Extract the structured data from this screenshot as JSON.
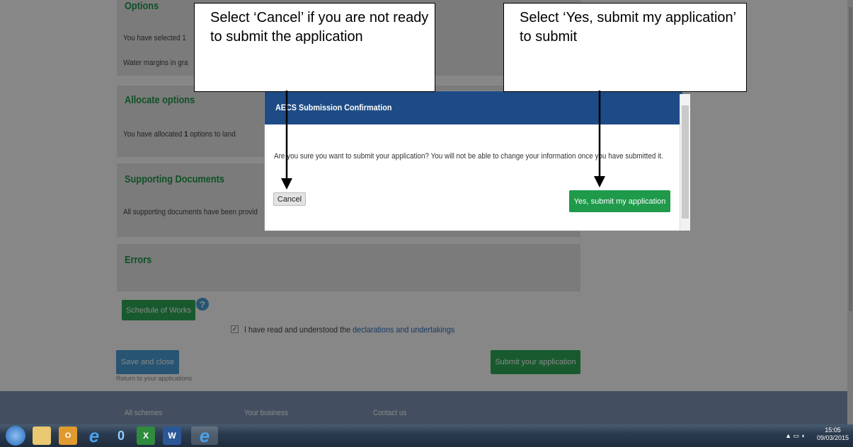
{
  "panels": {
    "options": {
      "title": "Options",
      "line1_prefix": "You have selected 1",
      "line2": "Water margins in gra"
    },
    "allocate": {
      "title": "Allocate options",
      "text_prefix": "You have allocated",
      "count": "1",
      "text_suffix": "options to land"
    },
    "supporting": {
      "title": "Supporting Documents",
      "text": "All supporting documents have been provid"
    },
    "errors": {
      "title": "Errors"
    }
  },
  "buttons": {
    "schedule": "Schedule of Works",
    "help_icon": "?",
    "save_close": "Save and close",
    "return_link": "Return to your applications",
    "submit_application": "Submit your application"
  },
  "declaration": {
    "text": "I have read and understood the",
    "link": "declarations and undertakings",
    "checked": true
  },
  "footer": {
    "col1": "All schemes",
    "col2": "Your business",
    "col3": "Contact us"
  },
  "modal": {
    "title": "AECS Submission Confirmation",
    "body": "Are you sure you want to submit your application? You will not be able to change your information once you have submitted it.",
    "cancel": "Cancel",
    "confirm": "Yes, submit my application"
  },
  "callouts": {
    "cancel_note": "Select ‘Cancel’ if you are not ready to submit the application",
    "submit_note": "Select ‘Yes, submit my application’ to submit"
  },
  "taskbar": {
    "icons": [
      "start-orb-icon",
      "file-explorer-icon",
      "outlook-icon",
      "internet-explorer-icon",
      "app-icon",
      "excel-icon",
      "word-icon",
      "internet-explorer-active-icon"
    ],
    "time": "15:05",
    "date": "09/03/2015"
  },
  "colors": {
    "green": "#1e9a4a",
    "blue_button": "#4a9fd8",
    "modal_header": "#1e4b85",
    "footer": "#7f96b5"
  }
}
